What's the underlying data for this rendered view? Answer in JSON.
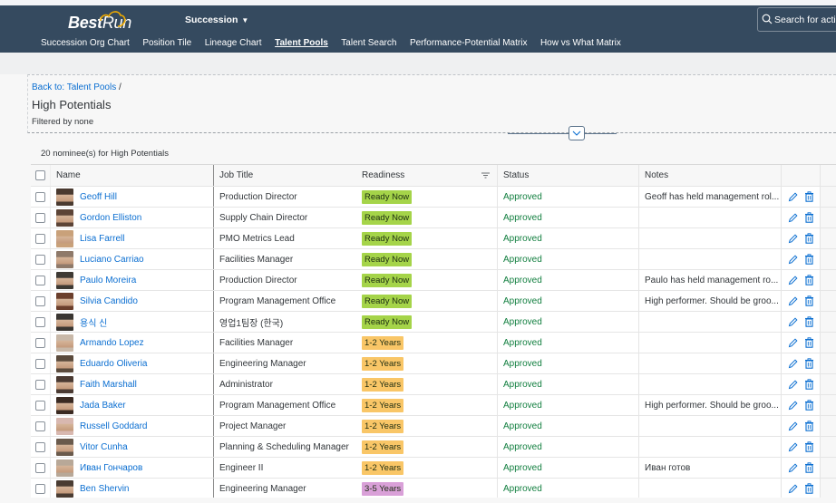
{
  "shell": {
    "logo_bold": "Best",
    "logo_light": "Run",
    "app_menu": "Succession",
    "search_placeholder": "Search for actions"
  },
  "nav": [
    {
      "label": "Succession Org Chart",
      "active": false
    },
    {
      "label": "Position Tile",
      "active": false
    },
    {
      "label": "Lineage Chart",
      "active": false
    },
    {
      "label": "Talent Pools",
      "active": true
    },
    {
      "label": "Talent Search",
      "active": false
    },
    {
      "label": "Performance-Potential Matrix",
      "active": false
    },
    {
      "label": "How vs What Matrix",
      "active": false
    }
  ],
  "header": {
    "breadcrumb_link": "Back to: Talent Pools",
    "breadcrumb_sep": "/",
    "title": "High Potentials",
    "filter": "Filtered by none"
  },
  "table": {
    "count_label": "20 nominee(s) for High Potentials",
    "columns": {
      "name": "Name",
      "job": "Job Title",
      "readiness": "Readiness",
      "status": "Status",
      "notes": "Notes"
    },
    "readiness_colors": {
      "Ready Now": "#a5d449",
      "1-2 Years": "#f9c667",
      "3-5 Years": "#d9a0d8"
    },
    "rows": [
      {
        "name": "Geoff Hill",
        "job": "Production Director",
        "readiness": "Ready Now",
        "status": "Approved",
        "notes": "Geoff has held management rol...",
        "avatar_color": "#4a3a30"
      },
      {
        "name": "Gordon Elliston",
        "job": "Supply Chain Director",
        "readiness": "Ready Now",
        "status": "Approved",
        "notes": "",
        "avatar_color": "#5c4436"
      },
      {
        "name": "Lisa Farrell",
        "job": "PMO Metrics Lead",
        "readiness": "Ready Now",
        "status": "Approved",
        "notes": "",
        "avatar_color": "#c9a17a"
      },
      {
        "name": "Luciano Carriao",
        "job": "Facilities Manager",
        "readiness": "Ready Now",
        "status": "Approved",
        "notes": "",
        "avatar_color": "#8f7a6a"
      },
      {
        "name": "Paulo Moreira",
        "job": "Production Director",
        "readiness": "Ready Now",
        "status": "Approved",
        "notes": "Paulo has held management ro...",
        "avatar_color": "#3e3a34"
      },
      {
        "name": "Silvia Candido",
        "job": "Program Management Office",
        "readiness": "Ready Now",
        "status": "Approved",
        "notes": "High performer. Should be groo...",
        "avatar_color": "#6b3f2c"
      },
      {
        "name": "용식 신",
        "job": "영업1팀장 (한국)",
        "readiness": "Ready Now",
        "status": "Approved",
        "notes": "",
        "avatar_color": "#3a3632"
      },
      {
        "name": "Armando Lopez",
        "job": "Facilities Manager",
        "readiness": "1-2 Years",
        "status": "Approved",
        "notes": "",
        "avatar_color": "#c8b8a8"
      },
      {
        "name": "Eduardo Oliveria",
        "job": "Engineering Manager",
        "readiness": "1-2 Years",
        "status": "Approved",
        "notes": "",
        "avatar_color": "#5a4a3c"
      },
      {
        "name": "Faith Marshall",
        "job": "Administrator",
        "readiness": "1-2 Years",
        "status": "Approved",
        "notes": "",
        "avatar_color": "#4a3a32"
      },
      {
        "name": "Jada Baker",
        "job": "Program Management Office",
        "readiness": "1-2 Years",
        "status": "Approved",
        "notes": "High performer. Should be groo...",
        "avatar_color": "#3a2a22"
      },
      {
        "name": "Russell Goddard",
        "job": "Project Manager",
        "readiness": "1-2 Years",
        "status": "Approved",
        "notes": "",
        "avatar_color": "#d8b8b0"
      },
      {
        "name": "Vitor Cunha",
        "job": "Planning & Scheduling Manager",
        "readiness": "1-2 Years",
        "status": "Approved",
        "notes": "",
        "avatar_color": "#6a5a4c"
      },
      {
        "name": "Иван Гончаров",
        "job": "Engineer II",
        "readiness": "1-2 Years",
        "status": "Approved",
        "notes": "Иван готов",
        "avatar_color": "#b8a898"
      },
      {
        "name": "Ben Shervin",
        "job": "Engineering Manager",
        "readiness": "3-5 Years",
        "status": "Approved",
        "notes": "",
        "avatar_color": "#4a3c32"
      }
    ]
  },
  "icons": {
    "search": "search-icon",
    "caret": "caret-down-icon",
    "collapse": "chevron-down-icon",
    "sort": "sort-icon",
    "edit": "pencil-icon",
    "delete": "trash-icon"
  }
}
